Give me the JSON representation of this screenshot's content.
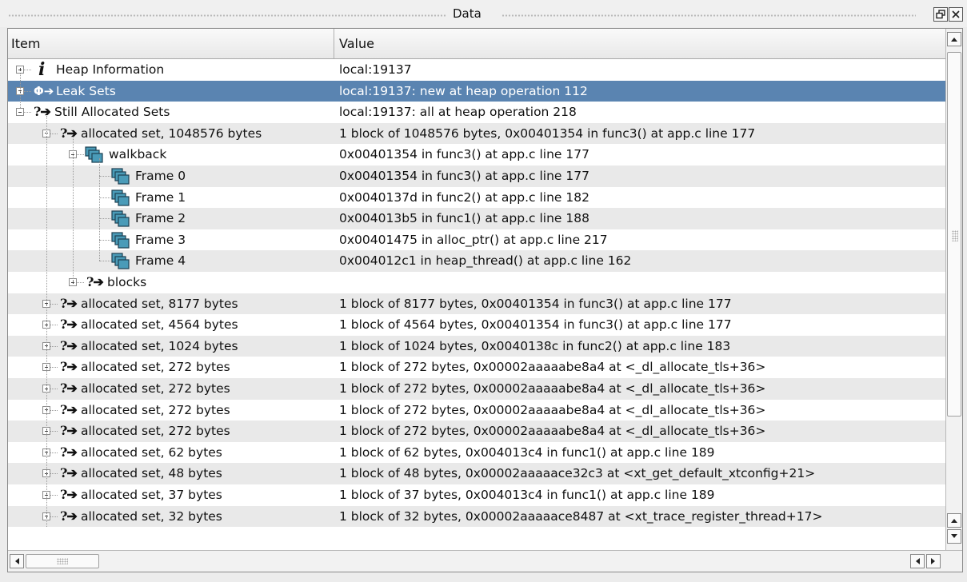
{
  "panel": {
    "title": "Data"
  },
  "columns": {
    "item": "Item",
    "value": "Value"
  },
  "rows": [
    {
      "label": "Heap Information",
      "value": "local:19137",
      "icon": "info-icon",
      "depth": 0,
      "expander": "plus",
      "selected": false
    },
    {
      "label": "Leak Sets",
      "value": "local:19137: new at heap operation 112",
      "icon": "leak-set-icon",
      "depth": 0,
      "expander": "plus",
      "selected": true
    },
    {
      "label": "Still Allocated Sets",
      "value": "local:19137: all at heap operation 218",
      "icon": "question-arrow-icon",
      "depth": 0,
      "expander": "minus",
      "selected": false
    },
    {
      "label": "allocated set, 1048576 bytes",
      "value": "1 block of 1048576 bytes, 0x00401354 in func3() at app.c line 177",
      "icon": "question-arrow-icon",
      "depth": 1,
      "expander": "minus",
      "selected": false
    },
    {
      "label": "walkback",
      "value": "0x00401354 in func3() at app.c line 177",
      "icon": "stack-frames-icon",
      "depth": 2,
      "expander": "minus",
      "selected": false
    },
    {
      "label": "Frame 0",
      "value": "0x00401354 in func3() at app.c line 177",
      "icon": "stack-frames-icon",
      "depth": 3,
      "expander": "none",
      "selected": false
    },
    {
      "label": "Frame 1",
      "value": "0x0040137d in func2() at app.c line 182",
      "icon": "stack-frames-icon",
      "depth": 3,
      "expander": "none",
      "selected": false
    },
    {
      "label": "Frame 2",
      "value": "0x004013b5 in func1() at app.c line 188",
      "icon": "stack-frames-icon",
      "depth": 3,
      "expander": "none",
      "selected": false
    },
    {
      "label": "Frame 3",
      "value": "0x00401475 in alloc_ptr() at app.c line 217",
      "icon": "stack-frames-icon",
      "depth": 3,
      "expander": "none",
      "selected": false
    },
    {
      "label": "Frame 4",
      "value": "0x004012c1 in heap_thread() at app.c line 162",
      "icon": "stack-frames-icon",
      "depth": 3,
      "expander": "none",
      "selected": false
    },
    {
      "label": "blocks",
      "value": "",
      "icon": "question-arrow-icon",
      "depth": 2,
      "expander": "plus",
      "selected": false
    },
    {
      "label": "allocated set, 8177 bytes",
      "value": "1 block of 8177 bytes, 0x00401354 in func3() at app.c line 177",
      "icon": "question-arrow-icon",
      "depth": 1,
      "expander": "plus",
      "selected": false
    },
    {
      "label": "allocated set, 4564 bytes",
      "value": "1 block of 4564 bytes, 0x00401354 in func3() at app.c line 177",
      "icon": "question-arrow-icon",
      "depth": 1,
      "expander": "plus",
      "selected": false
    },
    {
      "label": "allocated set, 1024 bytes",
      "value": "1 block of 1024 bytes, 0x0040138c in func2() at app.c line 183",
      "icon": "question-arrow-icon",
      "depth": 1,
      "expander": "plus",
      "selected": false
    },
    {
      "label": "allocated set, 272 bytes",
      "value": "1 block of 272 bytes, 0x00002aaaaabe8a4 at <_dl_allocate_tls+36>",
      "icon": "question-arrow-icon",
      "depth": 1,
      "expander": "plus",
      "selected": false
    },
    {
      "label": "allocated set, 272 bytes",
      "value": "1 block of 272 bytes, 0x00002aaaaabe8a4 at <_dl_allocate_tls+36>",
      "icon": "question-arrow-icon",
      "depth": 1,
      "expander": "plus",
      "selected": false
    },
    {
      "label": "allocated set, 272 bytes",
      "value": "1 block of 272 bytes, 0x00002aaaaabe8a4 at <_dl_allocate_tls+36>",
      "icon": "question-arrow-icon",
      "depth": 1,
      "expander": "plus",
      "selected": false
    },
    {
      "label": "allocated set, 272 bytes",
      "value": "1 block of 272 bytes, 0x00002aaaaabe8a4 at <_dl_allocate_tls+36>",
      "icon": "question-arrow-icon",
      "depth": 1,
      "expander": "plus",
      "selected": false
    },
    {
      "label": "allocated set, 62 bytes",
      "value": "1 block of 62 bytes, 0x004013c4 in func1() at app.c line 189",
      "icon": "question-arrow-icon",
      "depth": 1,
      "expander": "plus",
      "selected": false
    },
    {
      "label": "allocated set, 48 bytes",
      "value": "1 block of 48 bytes, 0x00002aaaaace32c3 at <xt_get_default_xtconfig+21>",
      "icon": "question-arrow-icon",
      "depth": 1,
      "expander": "plus",
      "selected": false
    },
    {
      "label": "allocated set, 37 bytes",
      "value": "1 block of 37 bytes, 0x004013c4 in func1() at app.c line 189",
      "icon": "question-arrow-icon",
      "depth": 1,
      "expander": "plus",
      "selected": false
    },
    {
      "label": "allocated set, 32 bytes",
      "value": "1 block of 32 bytes, 0x00002aaaaace8487 at <xt_trace_register_thread+17>",
      "icon": "question-arrow-icon",
      "depth": 1,
      "expander": "plus",
      "selected": false
    }
  ],
  "colors": {
    "selection": "#5a84b1",
    "alt_row": "#e9e9e9",
    "frame_icon_fill": "#4a9bb8"
  }
}
